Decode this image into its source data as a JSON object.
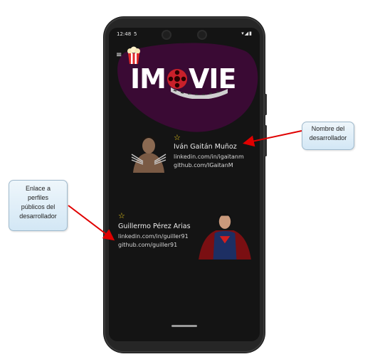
{
  "status_bar": {
    "time": "12:48",
    "sim_icon": "sim-icon",
    "indicators": "▾◢▮"
  },
  "app": {
    "logo_text_left": "IM",
    "logo_text_right": "VIE",
    "menu_icon": "≡"
  },
  "developers": [
    {
      "favorite_icon": "☆",
      "name": "Iván Gaitán Muñoz",
      "linkedin": "linkedin.com/in/igaitanm",
      "github": "github.com/IGaitanM",
      "avatar": "wolverine-avatar"
    },
    {
      "favorite_icon": "☆",
      "name": "Guillermo Pérez Arias",
      "linkedin": "linkedin.com/in/guiller91",
      "github": "github.com/guiller91",
      "avatar": "superman-avatar"
    }
  ],
  "callouts": {
    "name_label": [
      "Nombre del",
      "desarrollador"
    ],
    "link_label": [
      "Enlace a",
      "perfiles",
      "públicos del",
      "desarrollador"
    ]
  },
  "colors": {
    "screen_bg": "#141414",
    "blob": "#3a0a34",
    "star": "#f2d11c",
    "arrow": "#e00000"
  }
}
